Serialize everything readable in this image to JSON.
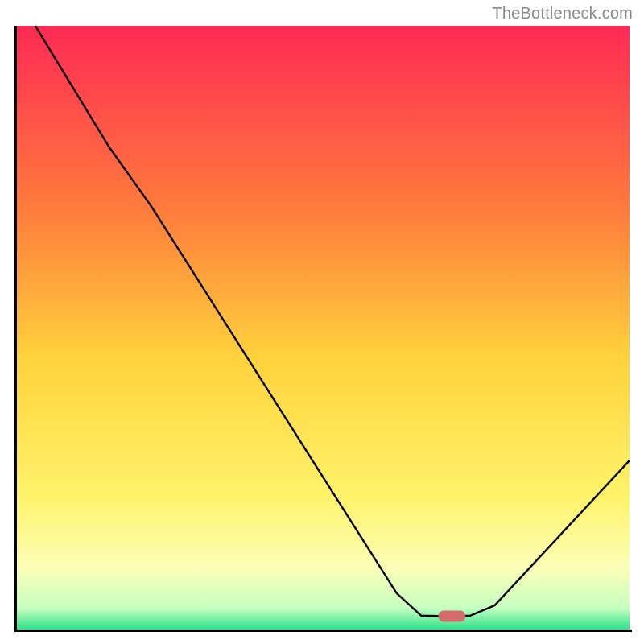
{
  "watermark": "TheBottleneck.com",
  "chart_data": {
    "type": "line",
    "title": "",
    "xlabel": "",
    "ylabel": "",
    "xlim": [
      0,
      100
    ],
    "ylim": [
      0,
      100
    ],
    "grid": false,
    "curve": [
      {
        "x": 3.0,
        "y": 100.0
      },
      {
        "x": 15.0,
        "y": 80.0
      },
      {
        "x": 22.0,
        "y": 70.0
      },
      {
        "x": 62.0,
        "y": 6.0
      },
      {
        "x": 66.0,
        "y": 2.3
      },
      {
        "x": 70.0,
        "y": 2.2
      },
      {
        "x": 74.0,
        "y": 2.3
      },
      {
        "x": 78.0,
        "y": 4.0
      },
      {
        "x": 100.0,
        "y": 28.0
      }
    ],
    "marker": {
      "x": 71.0,
      "y": 2.2,
      "color": "#d26b6b"
    },
    "gradient_stops": [
      {
        "offset": 0.0,
        "color": "#ff2a55"
      },
      {
        "offset": 0.3,
        "color": "#ff7a3c"
      },
      {
        "offset": 0.55,
        "color": "#ffd23c"
      },
      {
        "offset": 0.78,
        "color": "#fff36a"
      },
      {
        "offset": 0.9,
        "color": "#fbffb8"
      },
      {
        "offset": 0.965,
        "color": "#c4ffc0"
      },
      {
        "offset": 1.0,
        "color": "#2fe08a"
      }
    ]
  }
}
